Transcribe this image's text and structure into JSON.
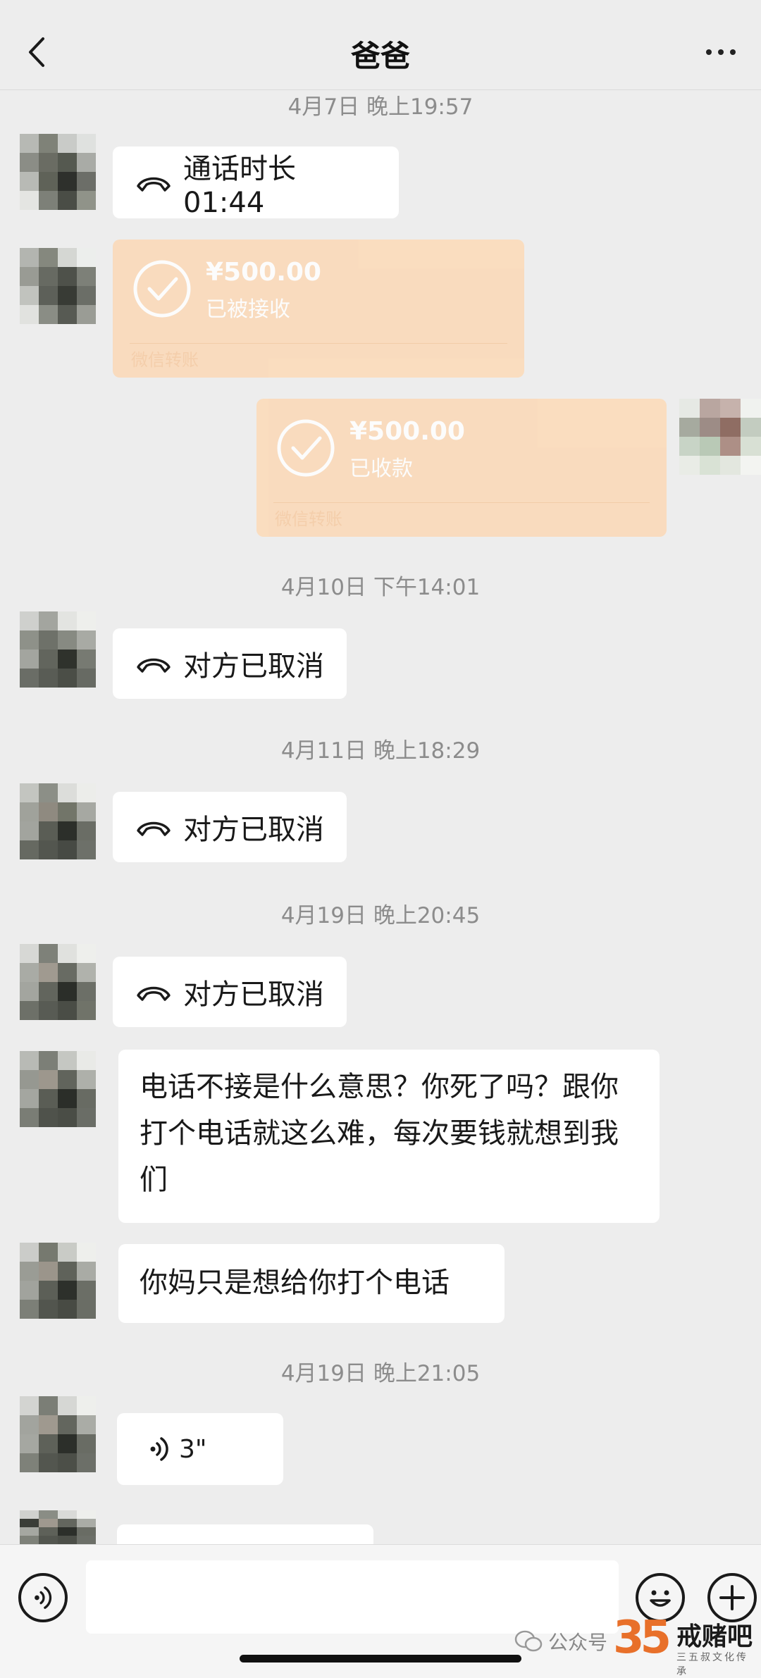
{
  "header": {
    "title": "爸爸"
  },
  "timestamps": {
    "t1": "4月7日 晚上19:57",
    "t2": "4月10日 下午14:01",
    "t3": "4月11日 晚上18:29",
    "t4": "4月19日 晚上20:45",
    "t5": "4月19日 晚上21:05"
  },
  "messages": {
    "call_duration": "通话时长 01:44",
    "transfer_in": {
      "amount": "¥500.00",
      "status": "已被接收",
      "footer": "微信转账"
    },
    "transfer_out": {
      "amount": "¥500.00",
      "status": "已收款",
      "footer": "微信转账"
    },
    "cancel_1": "对方已取消",
    "cancel_2": "对方已取消",
    "cancel_3": "对方已取消",
    "text_1": "电话不接是什么意思？你死了吗？跟你打个电话就这么难，每次要钱就想到我们",
    "text_2": "你妈只是想给你打个电话",
    "voice_duration": "3\""
  },
  "watermark": {
    "label": "公众号",
    "logo_number": "35",
    "logo_name": "戒赌吧",
    "logo_sub": "三五叔文化传承"
  },
  "colors": {
    "background": "#ededed",
    "bubble": "#ffffff",
    "transfer": "#fcd9b6",
    "timestamp": "#8c8c8c"
  }
}
